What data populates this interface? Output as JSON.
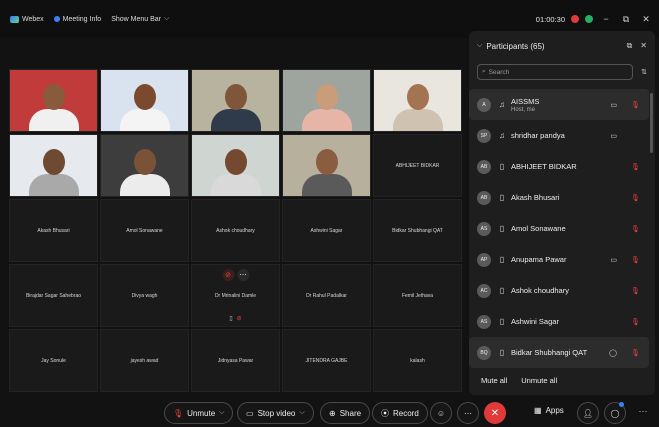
{
  "titlebar": {
    "app_name": "Webex",
    "meeting_info": "Meeting Info",
    "menu_bar": "Show Menu Bar",
    "timer": "01:00:30"
  },
  "tiles": [
    {
      "name": "",
      "video": true,
      "bg": "#c23b3b",
      "skin": "#8a5a3c",
      "shirt": "#f0f0f0"
    },
    {
      "name": "",
      "video": true,
      "bg": "#d9e3ef",
      "skin": "#7b4a2e",
      "shirt": "#f4f4f4"
    },
    {
      "name": "",
      "video": true,
      "bg": "#b7b39e",
      "skin": "#80563a",
      "shirt": "#2f3b4a"
    },
    {
      "name": "",
      "video": true,
      "bg": "#9ea59e",
      "skin": "#c99c7a",
      "shirt": "#e7b4a8"
    },
    {
      "name": "",
      "video": true,
      "bg": "#e9e6df",
      "skin": "#a37352",
      "shirt": "#cfc2b0"
    },
    {
      "name": "",
      "video": true,
      "bg": "#e6e9ee",
      "skin": "#6e4a33",
      "shirt": "#a9a9a9"
    },
    {
      "name": "",
      "video": true,
      "bg": "#3d3d3d",
      "skin": "#7a5238",
      "shirt": "#ececec"
    },
    {
      "name": "",
      "video": true,
      "bg": "#cfd6d2",
      "skin": "#74492f",
      "shirt": "#d9d9d9"
    },
    {
      "name": "",
      "video": true,
      "bg": "#b6b09c",
      "skin": "#8a5d40",
      "shirt": "#5a5a5a"
    },
    {
      "name": "ABHIJEET BIDKAR",
      "video": false
    },
    {
      "name": "Akash Bhusari",
      "video": false
    },
    {
      "name": "Amol Sonawane",
      "video": false
    },
    {
      "name": "Ashok choudhary",
      "video": false
    },
    {
      "name": "Ashwini Sagar",
      "video": false
    },
    {
      "name": "Bidkar Shubhangi QAT",
      "video": false
    },
    {
      "name": "Birajdar Sagar Sahebrao",
      "video": false
    },
    {
      "name": "Divya wagh",
      "video": false
    },
    {
      "name": "Dr Mrinalini Damle",
      "video": false
    },
    {
      "name": "Dr Rahul Padalkar",
      "video": false
    },
    {
      "name": "Femil Jethava",
      "video": false
    },
    {
      "name": "Jay Sonule",
      "video": false
    },
    {
      "name": "jayesh awad",
      "video": false
    },
    {
      "name": "Jidnyasa Pawar",
      "video": false
    },
    {
      "name": "JITENDRA GAJBE",
      "video": false
    },
    {
      "name": "kalash",
      "video": false
    }
  ],
  "panel": {
    "title": "Participants (65)",
    "search_placeholder": "Search",
    "participants": [
      {
        "initials": "A",
        "name": "AISSMS",
        "sub": "Host, me",
        "device": "headset",
        "cam": true,
        "muted": true
      },
      {
        "initials": "SP",
        "name": "shridhar pandya",
        "sub": "",
        "device": "headset",
        "cam": true,
        "muted": false
      },
      {
        "initials": "AB",
        "name": "ABHIJEET BIDKAR",
        "sub": "",
        "device": "phone",
        "cam": false,
        "muted": true
      },
      {
        "initials": "AB",
        "name": "Akash Bhusari",
        "sub": "",
        "device": "phone",
        "cam": false,
        "muted": true
      },
      {
        "initials": "AS",
        "name": "Amol Sonawane",
        "sub": "",
        "device": "phone",
        "cam": false,
        "muted": true
      },
      {
        "initials": "AP",
        "name": "Anupama Pawar",
        "sub": "",
        "device": "phone",
        "cam": true,
        "muted": true
      },
      {
        "initials": "AC",
        "name": "Ashok choudhary",
        "sub": "",
        "device": "phone",
        "cam": false,
        "muted": true
      },
      {
        "initials": "AS",
        "name": "Ashwini Sagar",
        "sub": "",
        "device": "phone",
        "cam": false,
        "muted": true
      },
      {
        "initials": "BQ",
        "name": "Bidkar Shubhangi QAT",
        "sub": "",
        "device": "phone",
        "cam": true,
        "muted": true
      }
    ],
    "mute_all": "Mute all",
    "unmute_all": "Unmute all"
  },
  "controls": {
    "unmute": "Unmute",
    "stop_video": "Stop video",
    "share": "Share",
    "record": "Record",
    "apps": "Apps"
  }
}
